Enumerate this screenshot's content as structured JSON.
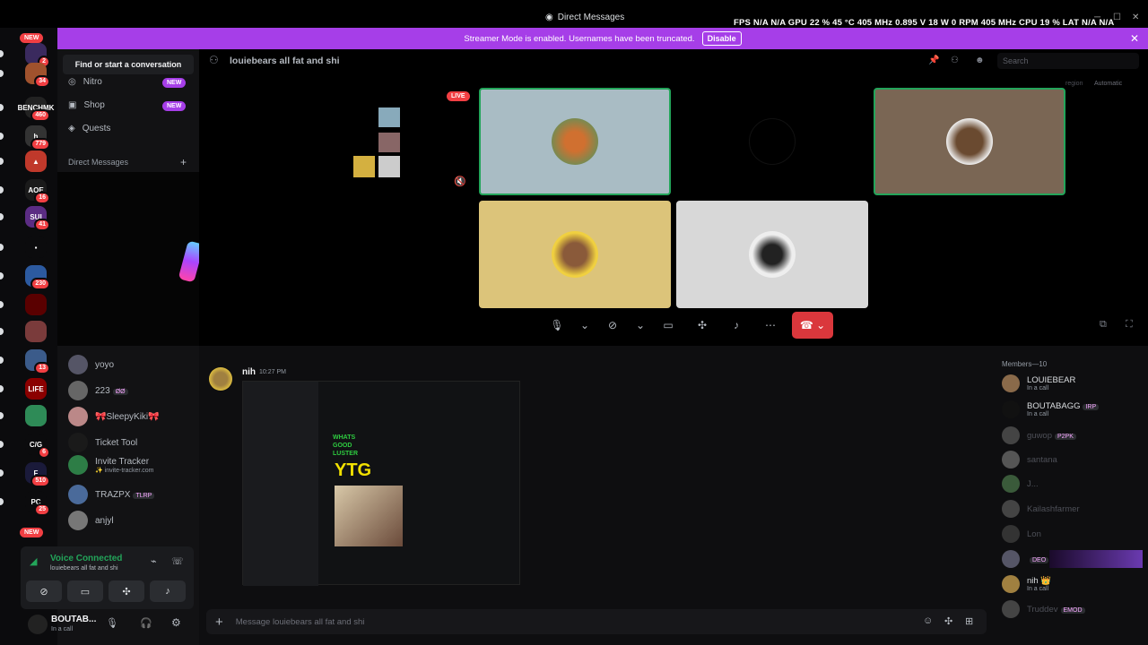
{
  "window": {
    "title": "Direct Messages"
  },
  "overlay": {
    "text": "FPS  N/A  N/A      GPU  22 %  45 °C  405 MHz  0.895 V  18 W  0 RPM  405 MHz      CPU  19 %      LAT  N/A  N/A"
  },
  "streamer": {
    "message": "Streamer Mode is enabled. Usernames have been truncated.",
    "disable_label": "Disable",
    "close": "✕"
  },
  "guilds": {
    "new_top": "NEW",
    "new_bottom": "NEW",
    "items": [
      {
        "label": "",
        "badge": "2",
        "color": "#3a2a5e"
      },
      {
        "label": "",
        "badge": "34",
        "color": "#a0522d"
      },
      {
        "label": "BENCHMK",
        "badge": "460",
        "color": "#222"
      },
      {
        "label": "h",
        "badge": "779",
        "color": "#333"
      },
      {
        "label": "▲",
        "badge": "",
        "color": "#c0392b"
      },
      {
        "label": "AOE",
        "badge": "16",
        "color": "#1a1a1a"
      },
      {
        "label": "SUI",
        "badge": "41",
        "color": "#5b2c83"
      },
      {
        "label": "▪",
        "badge": "",
        "color": "#0b0b0d"
      },
      {
        "label": "",
        "badge": "230",
        "color": "#2c5aa0"
      },
      {
        "label": "",
        "badge": "",
        "color": "#5a0000"
      },
      {
        "label": "",
        "badge": "",
        "color": "#7a3b3b"
      },
      {
        "label": "",
        "badge": "13",
        "color": "#3b5b8a"
      },
      {
        "label": "LIFE",
        "badge": "",
        "color": "#8b0000"
      },
      {
        "label": "",
        "badge": "",
        "color": "#2e8b57"
      },
      {
        "label": "C/G",
        "badge": "6",
        "color": "#0b0b0d"
      },
      {
        "label": "F",
        "badge": "510",
        "color": "#1a1a3a"
      },
      {
        "label": "PC",
        "badge": "25",
        "color": "#0b0b0d"
      }
    ]
  },
  "sidebar": {
    "find": "Find or start a conversation",
    "nav": [
      {
        "label": "Nitro",
        "badge": "NEW"
      },
      {
        "label": "Shop",
        "badge": "NEW"
      },
      {
        "label": "Quests",
        "badge": ""
      }
    ],
    "dm_header": "Direct Messages",
    "dm_plus": "+",
    "dms": [
      {
        "name": "yoyo",
        "sub": "",
        "tag": "",
        "color": "#556"
      },
      {
        "name": "223",
        "sub": "",
        "tag": "ØØ",
        "color": "#666"
      },
      {
        "name": "🎀SleepyKiki🎀",
        "sub": "",
        "tag": "",
        "color": "#b88"
      },
      {
        "name": "Ticket Tool",
        "sub": "",
        "tag": "",
        "color": "#1a1a1a"
      },
      {
        "name": "Invite Tracker",
        "sub": "✨ invite-tracker.com",
        "tag": "",
        "color": "#2d7d46"
      },
      {
        "name": "TRAZPX",
        "sub": "",
        "tag": "TLRP",
        "color": "#4a6a9a"
      },
      {
        "name": "anjyl",
        "sub": "",
        "tag": "",
        "color": "#777"
      }
    ]
  },
  "voice": {
    "title": "Voice Connected",
    "sub": "louiebears all fat and shi"
  },
  "user": {
    "name": "BOUTAB...",
    "status": "In a call"
  },
  "channel": {
    "title": "louiebears all fat and shi",
    "search_placeholder": "Search",
    "region": "region",
    "region_value": "Automatic"
  },
  "call": {
    "live": "LIVE"
  },
  "message": {
    "author": "nih",
    "time": "10:27 PM",
    "embedded": [
      "WHATS",
      "GOOD",
      "LUSTER",
      "YTG"
    ]
  },
  "members": {
    "header": "Members—10",
    "list": [
      {
        "name": "LOUIEBEAR",
        "status": "In a call",
        "tag": "",
        "color": "#dbdee1",
        "av": "#8a6a4a"
      },
      {
        "name": "BOUTABAGG",
        "status": "In a call",
        "tag": "IRP",
        "color": "#dbdee1",
        "av": "#111"
      },
      {
        "name": "guwop",
        "status": "",
        "tag": "P2PK",
        "color": "#4e5058",
        "av": "#444"
      },
      {
        "name": "santana",
        "status": "",
        "tag": "",
        "color": "#4e5058",
        "av": "#555"
      },
      {
        "name": "J...",
        "status": "",
        "tag": "",
        "color": "#4e5058",
        "av": "#3a5a3a"
      },
      {
        "name": "Kailashfarmer",
        "status": "",
        "tag": "",
        "color": "#4e5058",
        "av": "#444"
      },
      {
        "name": "Lon",
        "status": "",
        "tag": "",
        "color": "#4e5058",
        "av": "#333"
      },
      {
        "name": "",
        "status": "",
        "tag": "DEO",
        "color": "#4e5058",
        "av": "#556"
      },
      {
        "name": "nih 👑",
        "status": "In a call",
        "tag": "",
        "color": "#dbdee1",
        "av": "#a08040"
      },
      {
        "name": "Truddev",
        "status": "",
        "tag": "EMOD",
        "color": "#4e5058",
        "av": "#444"
      }
    ]
  },
  "composer": {
    "placeholder": "Message louiebears all fat and shi",
    "plus": "+"
  }
}
